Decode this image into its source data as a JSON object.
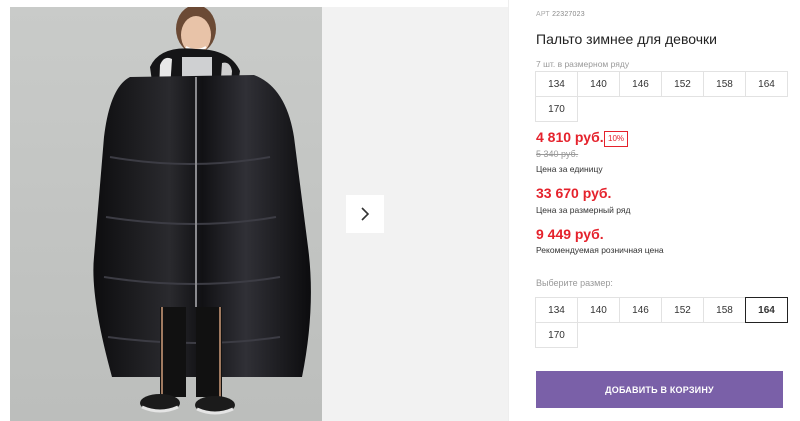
{
  "gallery": {
    "photo_alt": "product-photo",
    "next_icon": "chevron-right-icon"
  },
  "product": {
    "sku_label": "АРТ",
    "sku_value": "22327023",
    "title": "Пальто зимнее для девочки",
    "row_count_text": "7 шт. в размерном ряду",
    "row_sizes": [
      "134",
      "140",
      "146",
      "152",
      "158",
      "164",
      "170"
    ]
  },
  "pricing": {
    "unit_price": "4 810 руб.",
    "discount_badge": "10%",
    "old_price": "5 340 руб.",
    "unit_caption": "Цена за единицу",
    "row_price": "33 670 руб.",
    "row_caption": "Цена за размерный ряд",
    "rrp_price": "9 449 руб.",
    "rrp_caption": "Рекомендуемая розничная цена"
  },
  "size_picker": {
    "label": "Выберите размер:",
    "sizes": [
      "134",
      "140",
      "146",
      "152",
      "158",
      "164",
      "170"
    ],
    "selected": "164"
  },
  "cart": {
    "add_label": "ДОБАВИТЬ В КОРЗИНУ"
  },
  "colors": {
    "accent_red": "#e5222c",
    "button_purple": "#7a60a8"
  }
}
